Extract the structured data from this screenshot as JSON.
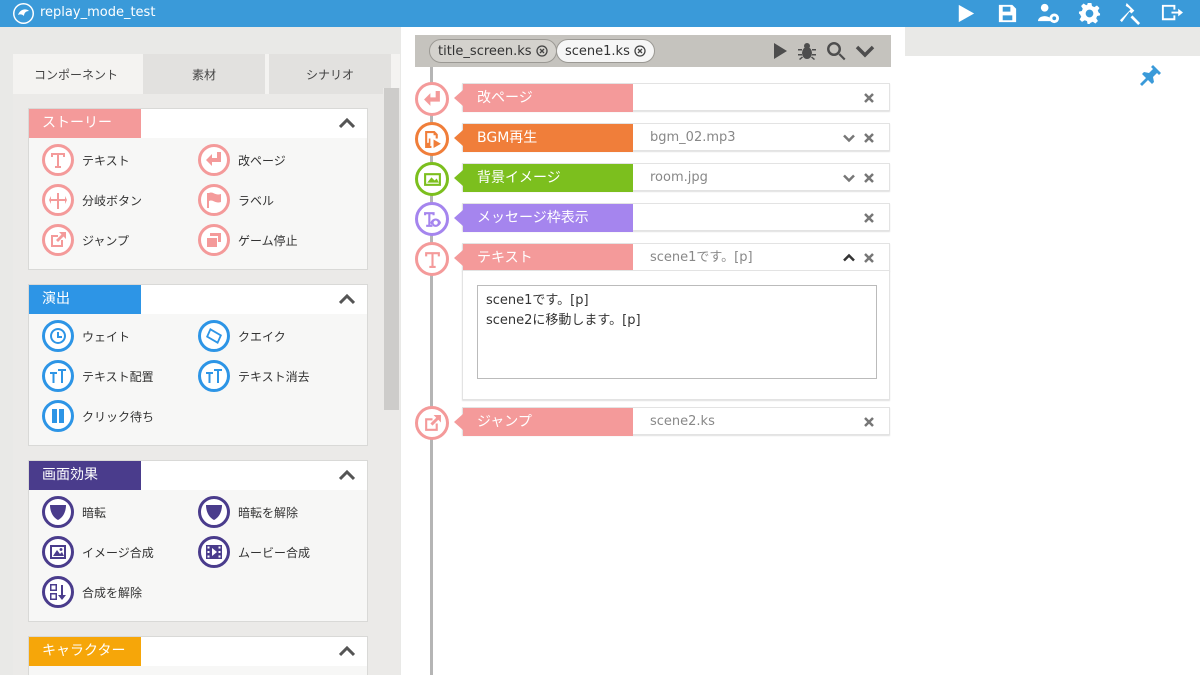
{
  "app": {
    "title": "replay_mode_test"
  },
  "toolbar": {
    "icons": [
      "play-icon",
      "save-icon",
      "users-gear-icon",
      "gear-icon",
      "hammer-icon",
      "exit-icon"
    ]
  },
  "tabs": [
    {
      "label": "コンポーネント",
      "active": true
    },
    {
      "label": "素材",
      "active": false
    },
    {
      "label": "シナリオ",
      "active": false
    }
  ],
  "categories": [
    {
      "id": "story",
      "label": "ストーリー",
      "color": "#f49a9a",
      "items": [
        {
          "label": "テキスト",
          "icon": "text-icon"
        },
        {
          "label": "改ページ",
          "icon": "page-break-icon"
        },
        {
          "label": "分岐ボタン",
          "icon": "branch-icon"
        },
        {
          "label": "ラベル",
          "icon": "flag-icon"
        },
        {
          "label": "ジャンプ",
          "icon": "jump-icon"
        },
        {
          "label": "ゲーム停止",
          "icon": "stop-icon"
        }
      ]
    },
    {
      "id": "effects",
      "label": "演出",
      "color": "#2d95e6",
      "items": [
        {
          "label": "ウェイト",
          "icon": "clock-icon"
        },
        {
          "label": "クエイク",
          "icon": "quake-icon"
        },
        {
          "label": "テキスト配置",
          "icon": "text-place-icon"
        },
        {
          "label": "テキスト消去",
          "icon": "text-clear-icon"
        },
        {
          "label": "クリック待ち",
          "icon": "pause-icon"
        }
      ]
    },
    {
      "id": "screen",
      "label": "画面効果",
      "color": "#4a3c8c",
      "items": [
        {
          "label": "暗転",
          "icon": "fade-icon"
        },
        {
          "label": "暗転を解除",
          "icon": "unfade-icon"
        },
        {
          "label": "イメージ合成",
          "icon": "image-icon"
        },
        {
          "label": "ムービー合成",
          "icon": "movie-icon"
        },
        {
          "label": "合成を解除",
          "icon": "uncompose-icon"
        }
      ]
    },
    {
      "id": "character",
      "label": "キャラクター",
      "color": "#f6a609",
      "items": []
    }
  ],
  "files": [
    {
      "name": "title_screen.ks",
      "active": false
    },
    {
      "name": "scene1.ks",
      "active": true
    }
  ],
  "filebar_icons": [
    "run-icon",
    "bug-icon",
    "search-icon",
    "chevron-down-icon"
  ],
  "scenario": [
    {
      "label": "改ページ",
      "value": "",
      "color": "#f49a9a",
      "icon": "page-break-icon",
      "arrow": "none"
    },
    {
      "label": "BGM再生",
      "value": "bgm_02.mp3",
      "color": "#f07e3a",
      "icon": "music-icon",
      "arrow": "down"
    },
    {
      "label": "背景イメージ",
      "value": "room.jpg",
      "color": "#7cbf1e",
      "icon": "background-icon",
      "arrow": "down"
    },
    {
      "label": "メッセージ枠表示",
      "value": "",
      "color": "#a585ee",
      "icon": "message-window-icon",
      "arrow": "none"
    },
    {
      "label": "テキスト",
      "value": "scene1です。[p]",
      "color": "#f49a9a",
      "icon": "text-icon",
      "arrow": "up"
    },
    {
      "label": "ジャンプ",
      "value": "scene2.ks",
      "color": "#f49a9a",
      "icon": "jump-icon",
      "arrow": "none"
    }
  ],
  "text_editor": {
    "value": "scene1です。[p]\nscene2に移動します。[p]"
  },
  "right_panel": {
    "icon": "pin-icon"
  }
}
